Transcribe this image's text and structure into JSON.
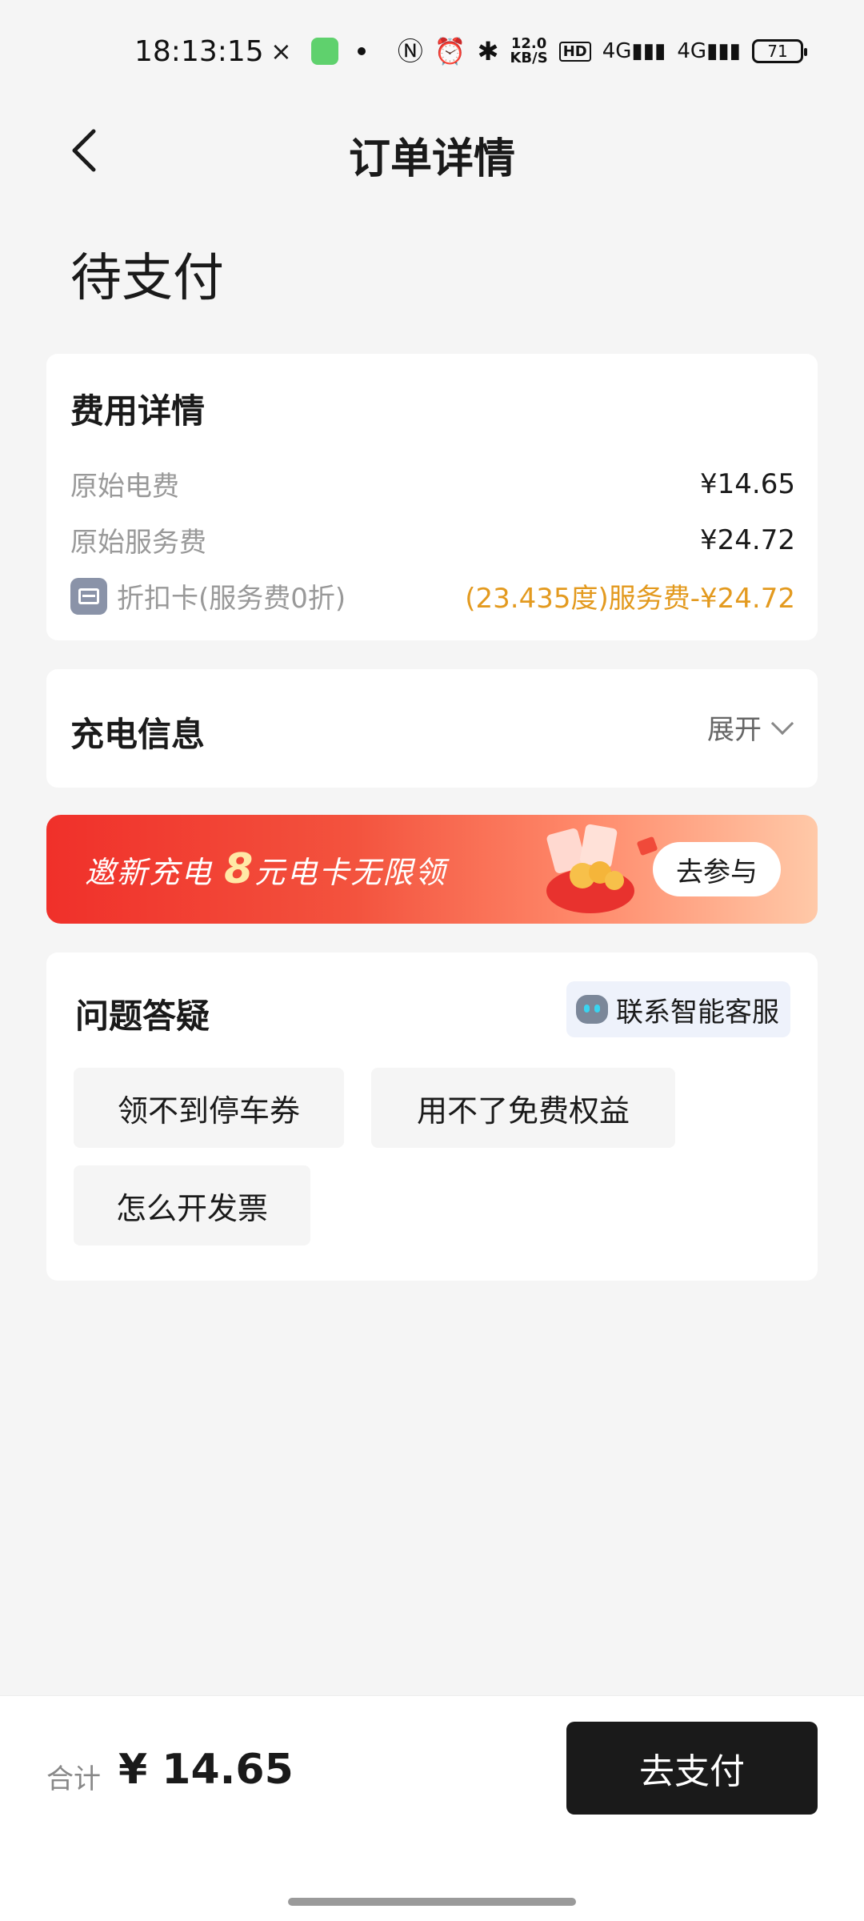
{
  "status_bar": {
    "time": "18:13:15",
    "net_speed_value": "12.0",
    "net_speed_unit": "KB/S",
    "hd_label": "HD",
    "signal_1": "4G",
    "signal_2": "4G",
    "battery": "71"
  },
  "nav": {
    "title": "订单详情"
  },
  "order": {
    "status": "待支付"
  },
  "fee_card": {
    "title": "费用详情",
    "rows": [
      {
        "label": "原始电费",
        "value": "¥14.65"
      },
      {
        "label": "原始服务费",
        "value": "¥24.72"
      },
      {
        "label": "折扣卡(服务费0折)",
        "value": "(23.435度)服务费-¥24.72"
      }
    ]
  },
  "charge_info": {
    "title": "充电信息",
    "expand_label": "展开"
  },
  "promo": {
    "text_prefix": "邀新充电",
    "text_highlight": "8",
    "text_suffix": "元电卡无限领",
    "button_label": "去参与"
  },
  "faq": {
    "title": "问题答疑",
    "support_label": "联系智能客服",
    "chips": [
      "领不到停车券",
      "用不了免费权益",
      "怎么开发票"
    ]
  },
  "footer": {
    "total_label": "合计",
    "total_value": "¥ 14.65",
    "pay_label": "去支付"
  },
  "colors": {
    "accent_orange": "#e39a1f",
    "pay_button": "#1a1a1a",
    "promo_red": "#f0302a"
  }
}
